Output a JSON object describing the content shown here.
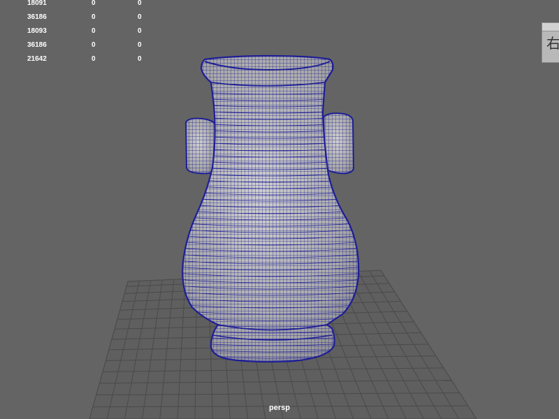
{
  "viewport": {
    "camera_label": "persp",
    "background_color": "#646464",
    "wireframe_color": "#1e1e96",
    "model_surface_color": "#b4b4b4",
    "grid_color": "#4a4a4a"
  },
  "heads_up_display": {
    "rows": [
      {
        "values": [
          "18091",
          "0",
          "0"
        ]
      },
      {
        "values": [
          "36186",
          "0",
          "0"
        ]
      },
      {
        "values": [
          "18093",
          "0",
          "0"
        ]
      },
      {
        "values": [
          "36186",
          "0",
          "0"
        ]
      },
      {
        "values": [
          "21642",
          "0",
          "0"
        ]
      }
    ]
  },
  "view_cube": {
    "face_label": "右"
  }
}
